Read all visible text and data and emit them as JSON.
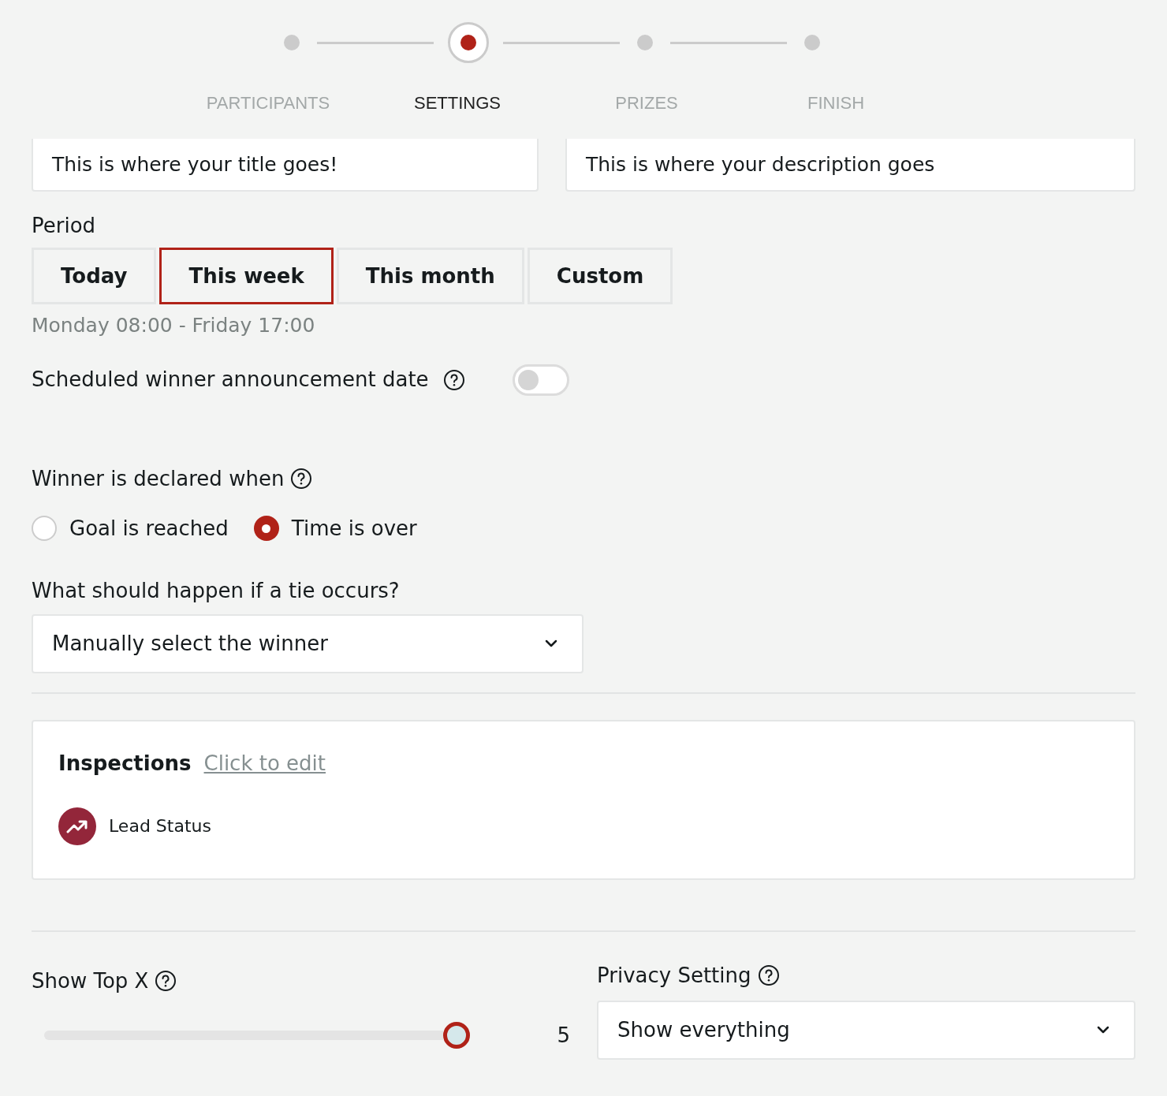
{
  "steps": [
    {
      "label": "PARTICIPANTS",
      "selected": false
    },
    {
      "label": "SETTINGS",
      "selected": true
    },
    {
      "label": "PRIZES",
      "selected": false
    },
    {
      "label": "FINISH",
      "selected": false
    }
  ],
  "title_field": {
    "value": "This is where your title goes!"
  },
  "description_field": {
    "value": "This is where your description goes"
  },
  "period": {
    "label": "Period",
    "options": [
      {
        "label": "Today",
        "selected": false
      },
      {
        "label": "This week",
        "selected": true
      },
      {
        "label": "This month",
        "selected": false
      },
      {
        "label": "Custom",
        "selected": false
      }
    ],
    "range": "Monday 08:00 - Friday 17:00"
  },
  "scheduled_announcement": {
    "label": "Scheduled winner announcement date",
    "on": false
  },
  "winner_declared": {
    "label": "Winner is declared when",
    "options": [
      {
        "label": "Goal is reached",
        "selected": false
      },
      {
        "label": "Time is over",
        "selected": true
      }
    ]
  },
  "tie": {
    "label": "What should happen if a tie occurs?",
    "value": "Manually select the winner"
  },
  "inspections": {
    "title": "Inspections",
    "edit_link": "Click to edit",
    "items": [
      {
        "label": "Lead Status"
      }
    ]
  },
  "show_top": {
    "label": "Show Top X",
    "level": 1,
    "reading": "5"
  },
  "privacy": {
    "label": "Privacy Setting",
    "value": "Show everything"
  }
}
